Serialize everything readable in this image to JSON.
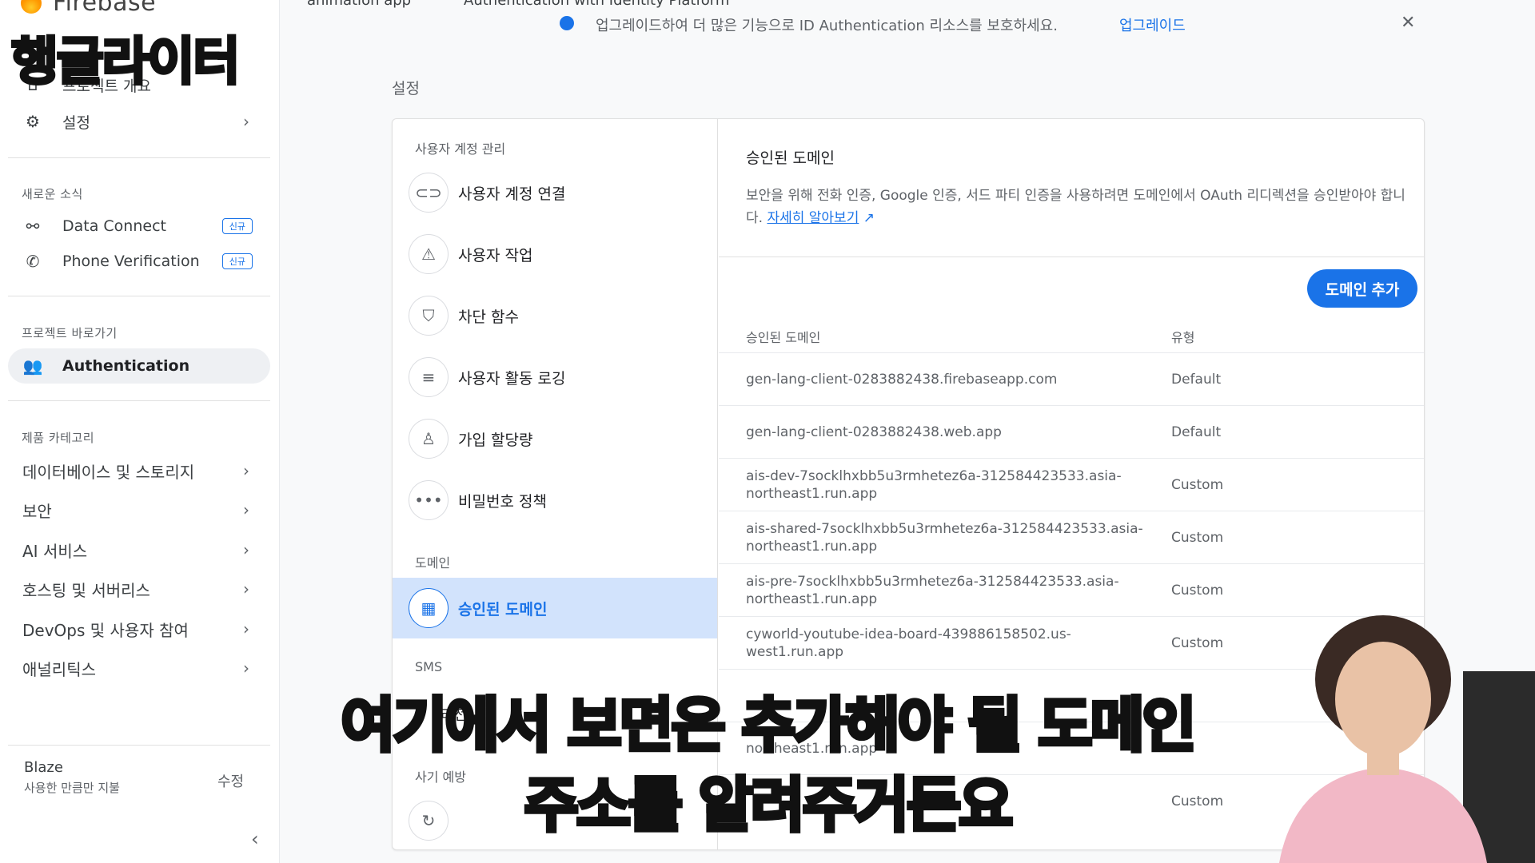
{
  "app": {
    "brand": "Firebase",
    "channel_logo": "행글라이터"
  },
  "topbar": {
    "project": "animation app",
    "crumb": "Authentication with Identity Platform",
    "banner_text": "업그레이드하여 더 많은 기능으로 ID Authentication 리소스를 보호하세요.",
    "banner_link": "업그레이드"
  },
  "sidebar": {
    "overview": "프로젝트 개요",
    "settings": "설정",
    "news_title": "새로운 소식",
    "news": [
      {
        "label": "Data Connect",
        "badge": "신규",
        "icon": "data-connect-icon"
      },
      {
        "label": "Phone Verification",
        "badge": "신규",
        "icon": "phone-icon"
      }
    ],
    "shortcuts_title": "프로젝트 바로가기",
    "shortcut_active": "Authentication",
    "category_title": "제품 카테고리",
    "categories": [
      "데이터베이스 및 스토리지",
      "보안",
      "AI 서비스",
      "호스팅 및 서버리스",
      "DevOps 및 사용자 참여",
      "애널리틱스"
    ],
    "plan_name": "Blaze",
    "plan_desc": "사용한 만큼만 지불",
    "plan_edit": "수정"
  },
  "page": {
    "title": "설정"
  },
  "leftnav": {
    "section_users": "사용자 계정 관리",
    "items": [
      {
        "label": "사용자 계정 연결",
        "icon": "link-icon"
      },
      {
        "label": "사용자 작업",
        "icon": "user-actions-icon"
      },
      {
        "label": "차단 함수",
        "icon": "shield-icon"
      },
      {
        "label": "사용자 활동 로깅",
        "icon": "activity-log-icon"
      },
      {
        "label": "가입 할당량",
        "icon": "quota-icon"
      },
      {
        "label": "비밀번호 정책",
        "icon": "password-icon"
      }
    ],
    "section_domain": "도메인",
    "active_item": "승인된 도메인",
    "section_sms": "SMS",
    "partial_item": "리전",
    "partial_item2": "사기 예방",
    "bottom_icon": "recaptcha-icon"
  },
  "domains": {
    "title": "승인된 도메인",
    "desc": "보안을 위해 전화 인증, Google 인증, 서드 파티 인증을 사용하려면 도메인에서 OAuth 리디렉션을 승인받아야 합니다.",
    "learn_more": "자세히 알아보기",
    "add_button": "도메인 추가",
    "col_domain": "승인된 도메인",
    "col_type": "유형",
    "rows": [
      {
        "domain": "gen-lang-client-0283882438.firebaseapp.com",
        "type": "Default"
      },
      {
        "domain": "gen-lang-client-0283882438.web.app",
        "type": "Default"
      },
      {
        "domain": "ais-dev-7socklhxbb5u3rmhetez6a-312584423533.asia-northeast1.run.app",
        "type": "Custom"
      },
      {
        "domain": "ais-shared-7socklhxbb5u3rmhetez6a-312584423533.asia-northeast1.run.app",
        "type": "Custom"
      },
      {
        "domain": "ais-pre-7socklhxbb5u3rmhetez6a-312584423533.asia-northeast1.run.app",
        "type": "Custom"
      },
      {
        "domain": "cyworld-youtube-idea-board-439886158502.us-west1.run.app",
        "type": "Custom"
      },
      {
        "domain": "",
        "type": ""
      },
      {
        "domain": "northeast1.run.app",
        "type": ""
      },
      {
        "domain": "",
        "type": "Custom"
      }
    ]
  },
  "subtitles": {
    "line1": "여기에서 보면은 추가해야 될 도메인",
    "line2": "주소를 알려주거든요"
  },
  "colors": {
    "accent": "#1a73e8",
    "active_bg": "#d2e3fc"
  }
}
